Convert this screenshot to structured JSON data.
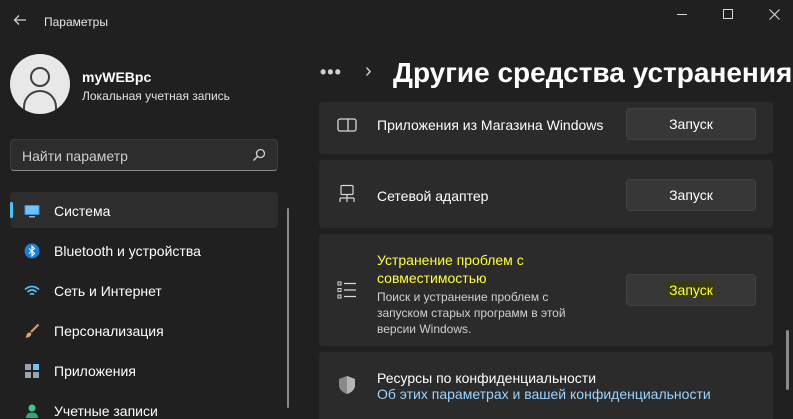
{
  "window": {
    "back_icon": "arrow-left-icon",
    "title": "Параметры",
    "controls": [
      "minimize-icon",
      "maximize-icon",
      "close-icon"
    ]
  },
  "profile": {
    "name": "myWEBpc",
    "subtitle": "Локальная учетная запись"
  },
  "search": {
    "placeholder": "Найти параметр",
    "icon": "search-icon"
  },
  "sidebar": {
    "items": [
      {
        "label": "Система",
        "icon": "monitor-icon",
        "active": true
      },
      {
        "label": "Bluetooth и устройства",
        "icon": "bluetooth-icon",
        "active": false
      },
      {
        "label": "Сеть и Интернет",
        "icon": "wifi-icon",
        "active": false
      },
      {
        "label": "Персонализация",
        "icon": "brush-icon",
        "active": false
      },
      {
        "label": "Приложения",
        "icon": "apps-icon",
        "active": false
      },
      {
        "label": "Учетные записи",
        "icon": "person-icon",
        "active": false
      }
    ]
  },
  "breadcrumb": {
    "more": "•••",
    "separator": "›",
    "title": "Другие средства устранения неполадок"
  },
  "troubleshooters": [
    {
      "title": "Приложения из Магазина Windows",
      "icon": "store-app-icon",
      "button": "Запуск"
    },
    {
      "title": "Сетевой адаптер",
      "icon": "network-adapter-icon",
      "button": "Запуск"
    },
    {
      "title_line1": "Устранение проблем с",
      "title_line2": "совместимостью",
      "description": "Поиск и устранение проблем с запуском старых программ в этой версии Windows.",
      "icon": "list-icon",
      "button": "Запуск"
    }
  ],
  "privacy": {
    "title": "Ресурсы по конфиденциальности",
    "link": "Об этих параметрах и вашей конфиденциальности",
    "icon": "shield-icon"
  },
  "colors": {
    "background": "#202020",
    "card": "#2b2b2b",
    "accent": "#4cc2ff",
    "link": "#99d4ff",
    "highlight": "#e8e000"
  }
}
